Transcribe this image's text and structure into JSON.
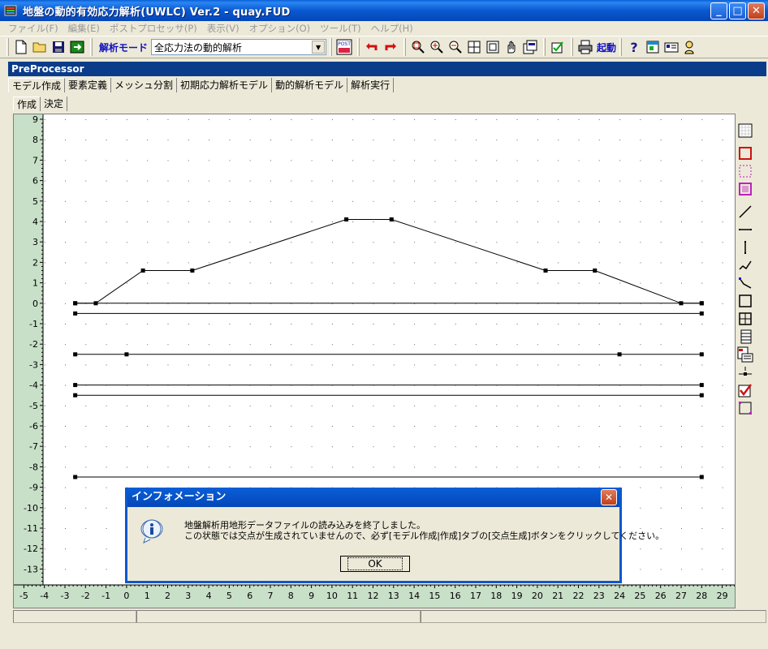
{
  "window": {
    "title": "地盤の動的有効応力解析(UWLC) Ver.2 - quay.FUD",
    "buttons": {
      "minimize": "_",
      "maximize": "□",
      "close": "✕"
    }
  },
  "menu": [
    "ファイル(F)",
    "編集(E)",
    "ポストプロセッサ(P)",
    "表示(V)",
    "オプション(O)",
    "ツール(T)",
    "ヘルプ(H)"
  ],
  "toolbar": {
    "mode_label": "解析モード",
    "mode_value": "全応力法の動的解析",
    "post_label": "POST",
    "kido_label": "起動"
  },
  "preprocessor": {
    "title": "PreProcessor",
    "tabs": [
      "モデル作成",
      "要素定義",
      "メッシュ分割",
      "初期応力解析モデル",
      "動的解析モデル",
      "解析実行"
    ],
    "subtabs": [
      "作成",
      "決定"
    ]
  },
  "axis": {
    "x_ticks": [
      "-5",
      "-4",
      "-3",
      "-2",
      "-1",
      "0",
      "1",
      "2",
      "3",
      "4",
      "5",
      "6",
      "7",
      "8",
      "9",
      "10",
      "11",
      "12",
      "13",
      "14",
      "15",
      "16",
      "17",
      "18",
      "19",
      "20",
      "21",
      "22",
      "23",
      "24",
      "25",
      "26",
      "27",
      "28",
      "29"
    ],
    "y_ticks": [
      "9",
      "8",
      "7",
      "6",
      "5",
      "4",
      "3",
      "2",
      "1",
      "0",
      "-1",
      "-2",
      "-3",
      "-4",
      "-5",
      "-6",
      "-7",
      "-8",
      "-9",
      "-10",
      "-11",
      "-12",
      "-13"
    ]
  },
  "geometry": {
    "polylines": [
      [
        [
          -2.5,
          0
        ],
        [
          -1.5,
          0
        ],
        [
          0.8,
          1.6
        ],
        [
          3.2,
          1.6
        ],
        [
          10.7,
          4.1
        ],
        [
          12.9,
          4.1
        ],
        [
          20.4,
          1.6
        ],
        [
          22.8,
          1.6
        ],
        [
          27.0,
          0
        ],
        [
          28,
          0
        ]
      ],
      [
        [
          -2.5,
          0
        ],
        [
          28,
          0
        ]
      ],
      [
        [
          -2.5,
          -0.5
        ],
        [
          28,
          -0.5
        ]
      ],
      [
        [
          -2.5,
          -2.5
        ],
        [
          0,
          -2.5
        ],
        [
          24,
          -2.5
        ],
        [
          28,
          -2.5
        ]
      ],
      [
        [
          -2.5,
          -4
        ],
        [
          28,
          -4
        ]
      ],
      [
        [
          -2.5,
          -4.5
        ],
        [
          28,
          -4.5
        ]
      ],
      [
        [
          -2.5,
          -8.5
        ],
        [
          28,
          -8.5
        ]
      ]
    ]
  },
  "dialog": {
    "title": "インフォメーション",
    "line1": "地盤解析用地形データファイルの読み込みを終了しました。",
    "line2": "この状態では交点が生成されていませんので、必ず[モデル作成|作成]タブの[交点生成]ボタンをクリックしてください。",
    "ok": "OK"
  },
  "colors": {
    "accent": "#0a58d0",
    "axis_bg": "#c8dfc8",
    "header_bg": "#0a3c8a"
  }
}
